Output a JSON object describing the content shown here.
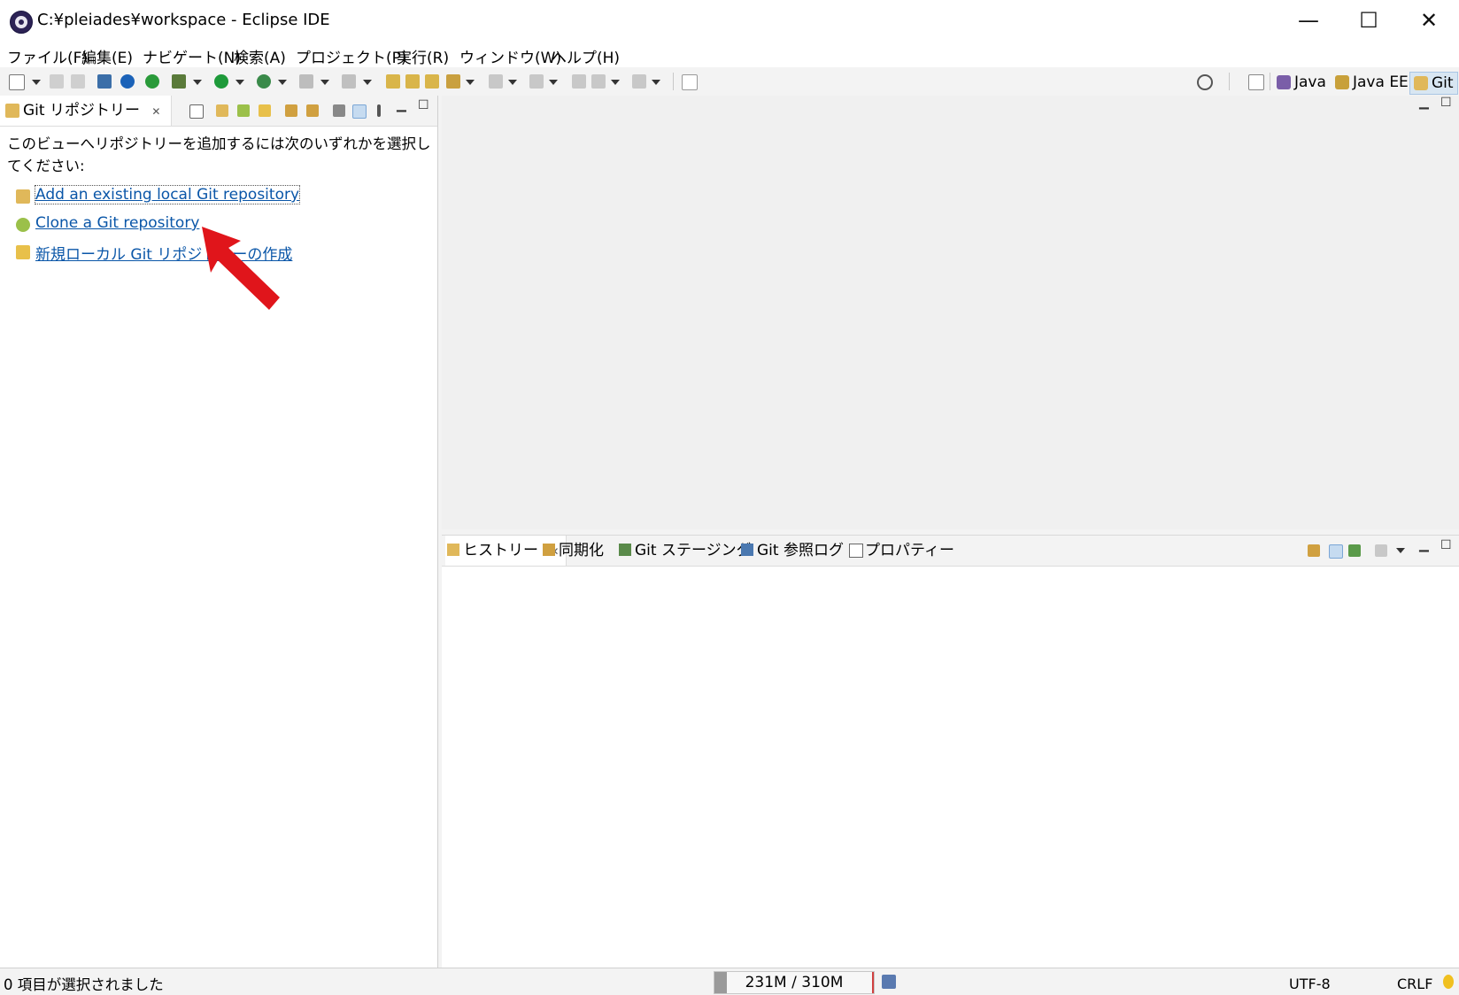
{
  "window": {
    "title": "C:¥pleiades¥workspace - Eclipse IDE",
    "controls": {
      "minimize": "—",
      "maximize": "☐",
      "close": "✕"
    }
  },
  "menu": {
    "items": [
      "ファイル(F)",
      "編集(E)",
      "ナビゲート(N)",
      "検索(A)",
      "プロジェクト(P)",
      "実行(R)",
      "ウィンドウ(W)",
      "ヘルプ(H)"
    ]
  },
  "perspectives": [
    {
      "label": "Java",
      "active": false
    },
    {
      "label": "Java EE",
      "active": false
    },
    {
      "label": "Git",
      "active": true
    }
  ],
  "git_view": {
    "tab_label": "Git リポジトリー",
    "intro": "このビューへリポジトリーを追加するには次のいずれかを選択してください:",
    "links": [
      {
        "label": "Add an existing local Git repository",
        "icon": "add-repo-icon"
      },
      {
        "label": "Clone a Git repository",
        "icon": "clone-repo-icon"
      },
      {
        "label": "新規ローカル Git リポジトリーの作成",
        "icon": "create-repo-icon"
      }
    ]
  },
  "bottom_tabs": [
    "ヒストリー",
    "同期化",
    "Git ステージング",
    "Git 参照ログ",
    "プロパティー"
  ],
  "status": {
    "message": "0 項目が選択されました",
    "heap": "231M / 310M",
    "heap_used_fraction": 0.745,
    "encoding": "UTF-8",
    "line_ending": "CRLF"
  },
  "colors": {
    "link": "#0a56a8",
    "active_perspective": "#d8e6f2",
    "annotation_arrow": "#e0151b"
  }
}
